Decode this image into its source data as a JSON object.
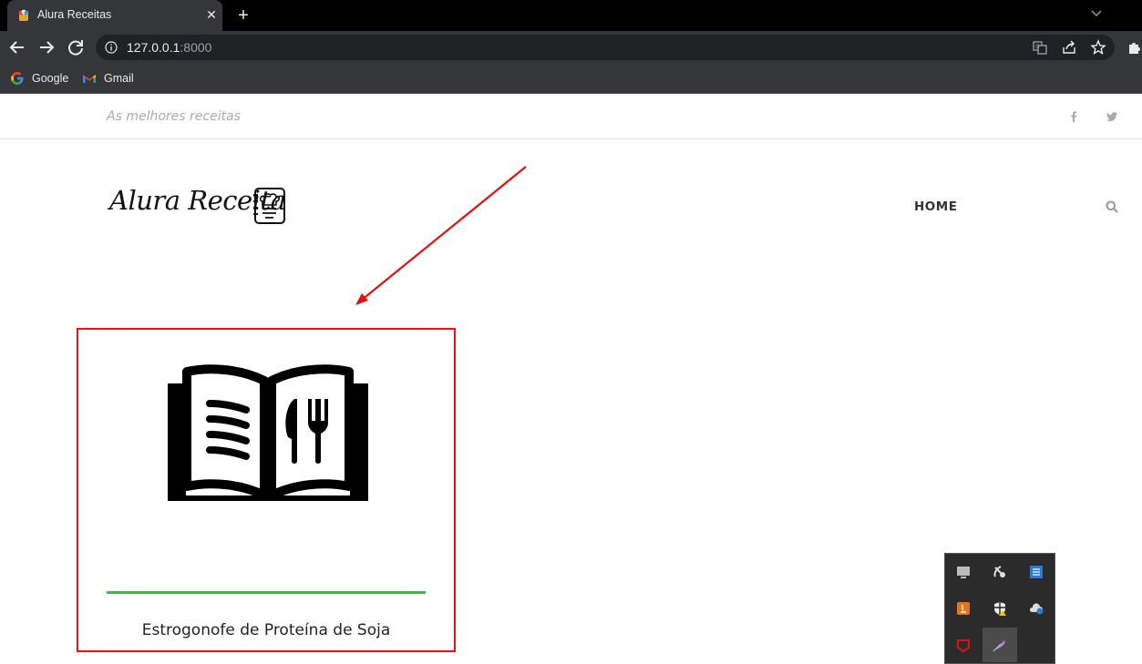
{
  "browser": {
    "tab_title": "Alura Receitas",
    "url_host": "127.0.0.1",
    "url_port": ":8000",
    "bookmarks": [
      {
        "label": "Google",
        "icon": "google-icon"
      },
      {
        "label": "Gmail",
        "icon": "gmail-icon"
      }
    ]
  },
  "site": {
    "tagline": "As melhores receitas",
    "logo_text": "Alura Receita",
    "nav": {
      "home": "HOME"
    },
    "social": [
      "facebook-icon",
      "twitter-icon"
    ]
  },
  "recipes": [
    {
      "title": "Estrogonofe de Proteína de Soja",
      "image": "recipe-book-icon"
    }
  ],
  "annotation": {
    "color": "#e11111"
  },
  "colors": {
    "accent_bar": "#4caf50",
    "tab_bg": "#35363a",
    "chrome_black": "#000000"
  }
}
